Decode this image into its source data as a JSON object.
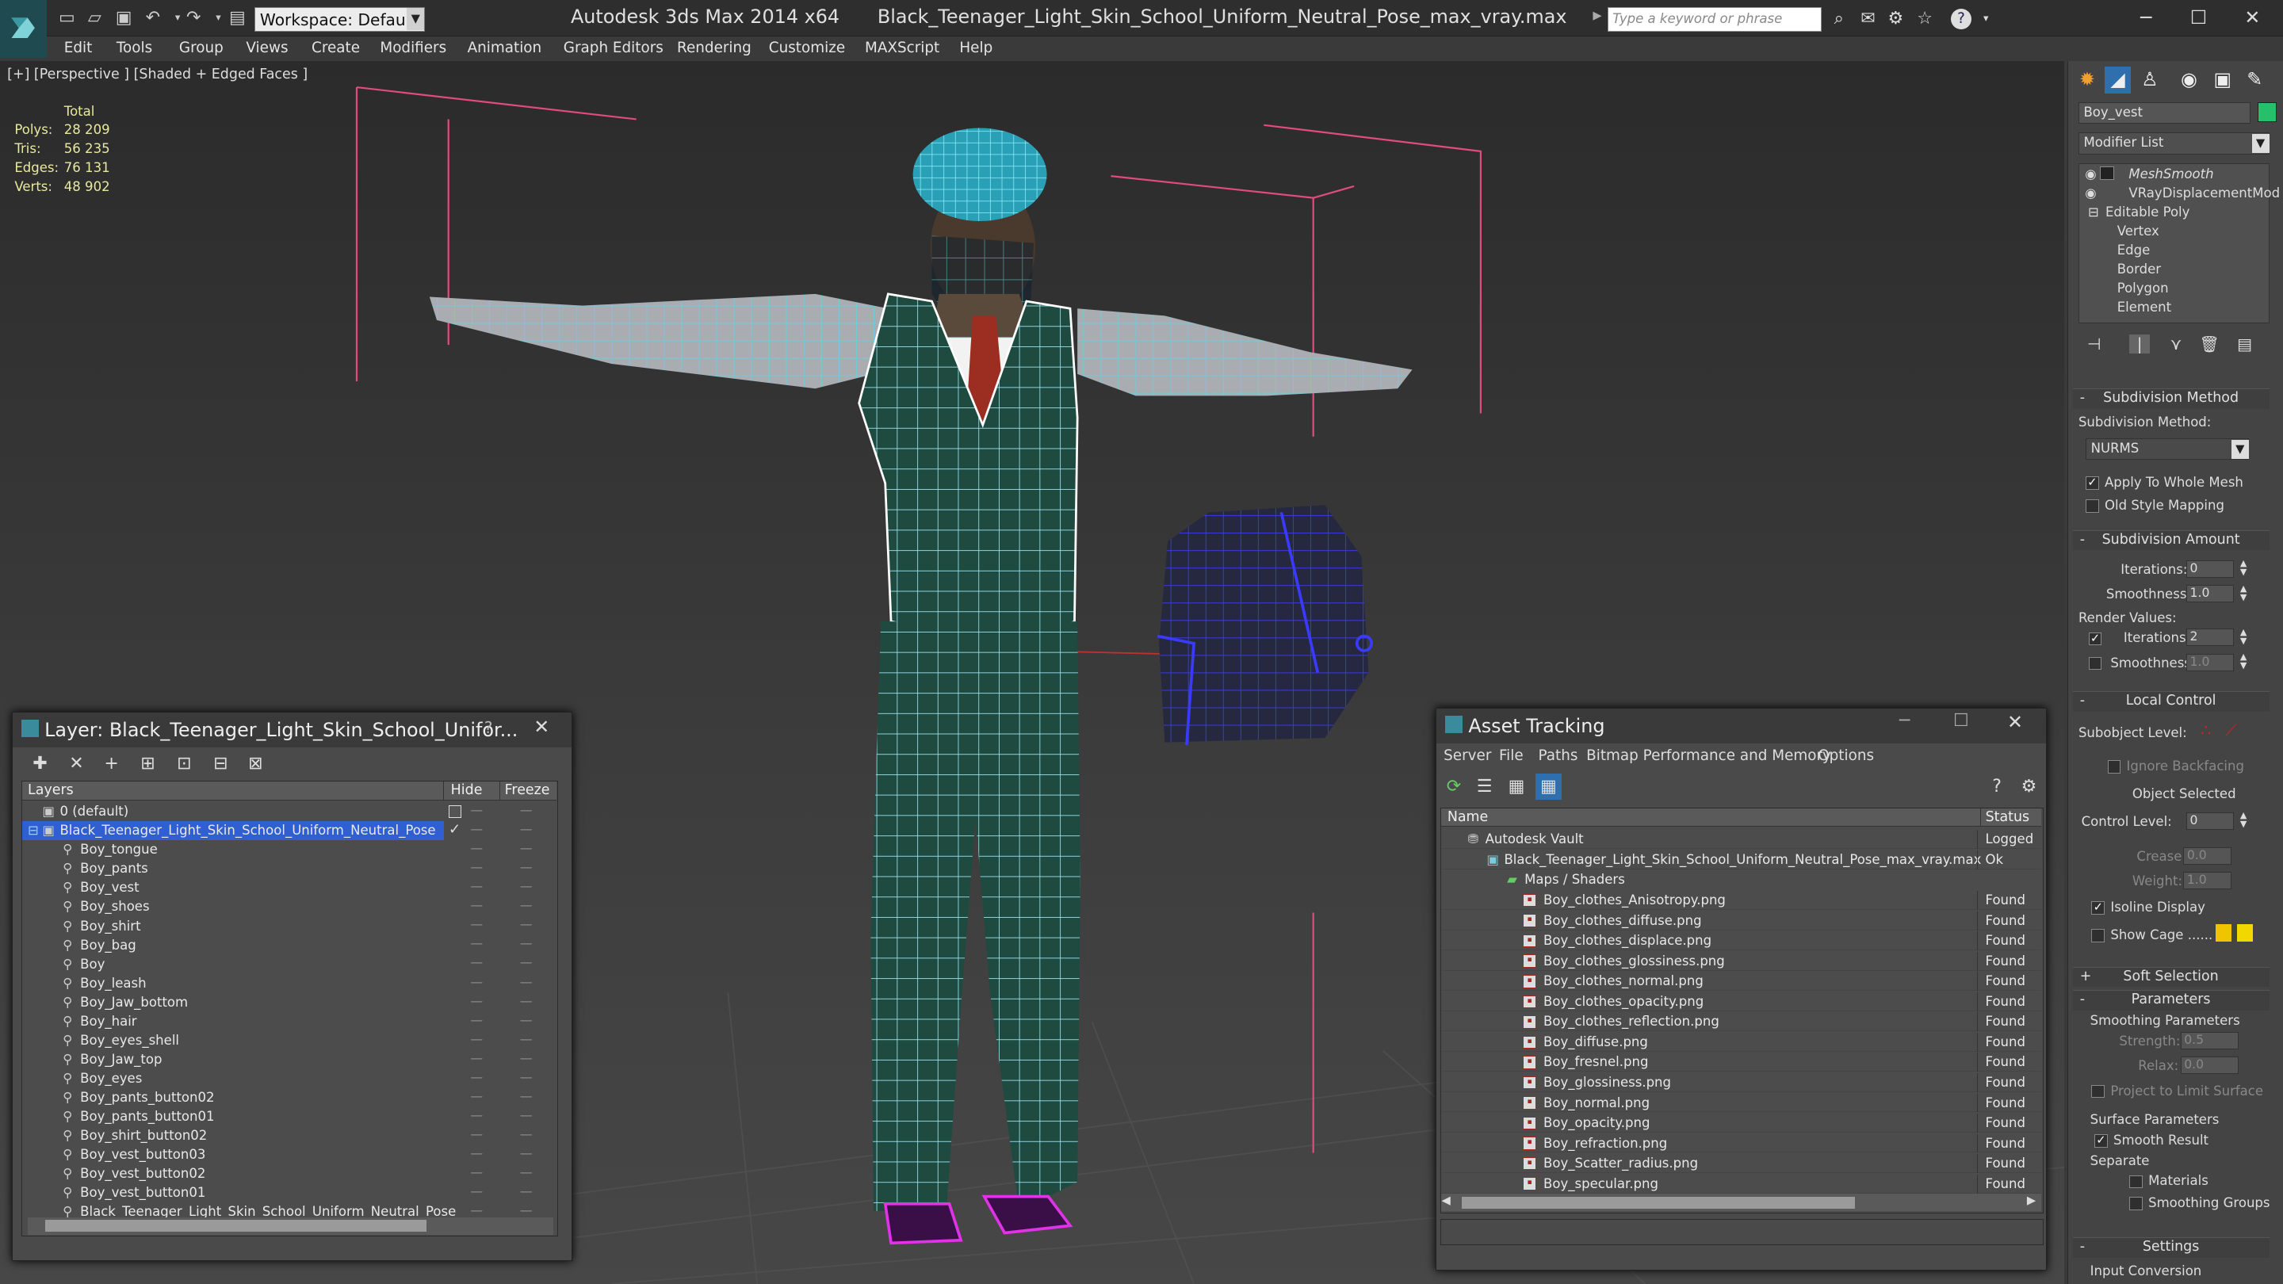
{
  "app": {
    "title": "Autodesk 3ds Max  2014 x64",
    "file": "Black_Teenager_Light_Skin_School_Uniform_Neutral_Pose_max_vray.max",
    "workspace": "Workspace: Default",
    "search_placeholder": "Type a keyword or phrase"
  },
  "menu": [
    "Edit",
    "Tools",
    "Group",
    "Views",
    "Create",
    "Modifiers",
    "Animation",
    "Graph Editors",
    "Rendering",
    "Customize",
    "MAXScript",
    "Help"
  ],
  "viewport": {
    "label": "[+] [Perspective ] [Shaded + Edged Faces ]",
    "stats": {
      "header": "Total",
      "rows": [
        {
          "k": "Polys:",
          "v": "28 209"
        },
        {
          "k": "Tris:",
          "v": "56 235"
        },
        {
          "k": "Edges:",
          "v": "76 131"
        },
        {
          "k": "Verts:",
          "v": "48 902"
        }
      ]
    }
  },
  "command_panel": {
    "object_name": "Boy_vest",
    "object_color": "#27c06a",
    "modifier_list": "Modifier List",
    "stack": [
      "MeshSmooth",
      "VRayDisplacementMod",
      "Editable Poly",
      "Vertex",
      "Edge",
      "Border",
      "Polygon",
      "Element"
    ],
    "subdivision_method": {
      "title": "Subdivision Method",
      "label": "Subdivision Method:",
      "value": "NURMS",
      "apply": "Apply To Whole Mesh",
      "old": "Old Style Mapping"
    },
    "subdivision_amount": {
      "title": "Subdivision Amount",
      "iter_label": "Iterations:",
      "iter": "0",
      "smooth_label": "Smoothness:",
      "smooth": "1.0",
      "render_values": "Render Values:",
      "r_iter": "2",
      "r_smooth": "1.0"
    },
    "local_control": {
      "title": "Local Control",
      "sublevel": "Subobject Level:",
      "ignore": "Ignore Backfacing",
      "selected": "Object Selected",
      "control_label": "Control Level:",
      "control": "0",
      "crease_label": "Crease:",
      "crease": "0.0",
      "weight_label": "Weight:",
      "weight": "1.0",
      "isoline": "Isoline Display",
      "cage": "Show Cage ......"
    },
    "soft_selection": "Soft Selection",
    "parameters": {
      "title": "Parameters",
      "smoothing": "Smoothing Parameters",
      "strength_label": "Strength:",
      "strength": "0.5",
      "relax_label": "Relax:",
      "relax": "0.0",
      "project": "Project to Limit Surface",
      "surface": "Surface Parameters",
      "smooth_result": "Smooth Result",
      "separate": "Separate",
      "materials": "Materials",
      "groups": "Smoothing Groups"
    },
    "settings": {
      "title": "Settings",
      "input": "Input Conversion"
    }
  },
  "layer_window": {
    "title": "Layer: Black_Teenager_Light_Skin_School_Unifor...",
    "help": "?",
    "columns": [
      "Layers",
      "Hide",
      "Freeze"
    ],
    "layers": [
      "0 (default)",
      "Black_Teenager_Light_Skin_School_Uniform_Neutral_Pose"
    ],
    "objects": [
      "Boy_tongue",
      "Boy_pants",
      "Boy_vest",
      "Boy_shoes",
      "Boy_shirt",
      "Boy_bag",
      "Boy",
      "Boy_leash",
      "Boy_Jaw_bottom",
      "Boy_hair",
      "Boy_eyes_shell",
      "Boy_Jaw_top",
      "Boy_eyes",
      "Boy_pants_button02",
      "Boy_pants_button01",
      "Boy_shirt_button02",
      "Boy_vest_button03",
      "Boy_vest_button02",
      "Boy_vest_button01",
      "Black_Teenager_Light_Skin_School_Uniform_Neutral_Pose"
    ]
  },
  "asset_window": {
    "title": "Asset Tracking",
    "menu": [
      "Server",
      "File",
      "Paths",
      "Bitmap Performance and Memory",
      "Options"
    ],
    "columns": [
      "Name",
      "Status"
    ],
    "vault": {
      "name": "Autodesk Vault",
      "status": "Logged"
    },
    "file": {
      "name": "Black_Teenager_Light_Skin_School_Uniform_Neutral_Pose_max_vray.max",
      "status": "Ok"
    },
    "maps": "Maps / Shaders",
    "assets": [
      {
        "n": "Boy_clothes_Anisotropy.png",
        "s": "Found"
      },
      {
        "n": "Boy_clothes_diffuse.png",
        "s": "Found"
      },
      {
        "n": "Boy_clothes_displace.png",
        "s": "Found"
      },
      {
        "n": "Boy_clothes_glossiness.png",
        "s": "Found"
      },
      {
        "n": "Boy_clothes_normal.png",
        "s": "Found"
      },
      {
        "n": "Boy_clothes_opacity.png",
        "s": "Found"
      },
      {
        "n": "Boy_clothes_reflection.png",
        "s": "Found"
      },
      {
        "n": "Boy_diffuse.png",
        "s": "Found"
      },
      {
        "n": "Boy_fresnel.png",
        "s": "Found"
      },
      {
        "n": "Boy_glossiness.png",
        "s": "Found"
      },
      {
        "n": "Boy_normal.png",
        "s": "Found"
      },
      {
        "n": "Boy_opacity.png",
        "s": "Found"
      },
      {
        "n": "Boy_refraction.png",
        "s": "Found"
      },
      {
        "n": "Boy_Scatter_radius.png",
        "s": "Found"
      },
      {
        "n": "Boy_specular.png",
        "s": "Found"
      }
    ]
  }
}
